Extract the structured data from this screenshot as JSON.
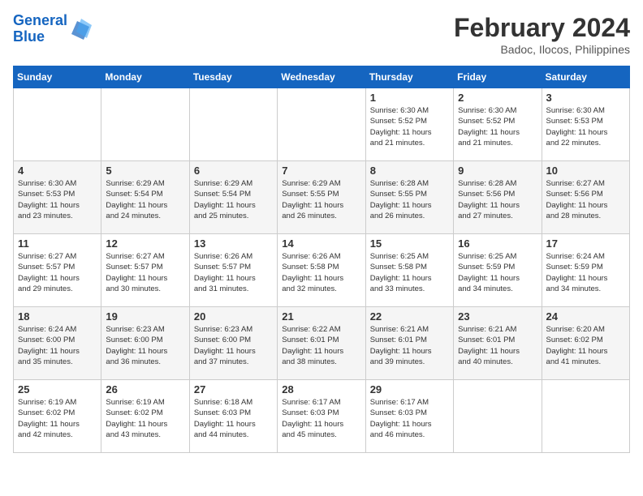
{
  "header": {
    "logo_line1": "General",
    "logo_line2": "Blue",
    "month_year": "February 2024",
    "location": "Badoc, Ilocos, Philippines"
  },
  "weekdays": [
    "Sunday",
    "Monday",
    "Tuesday",
    "Wednesday",
    "Thursday",
    "Friday",
    "Saturday"
  ],
  "weeks": [
    [
      {
        "day": "",
        "detail": ""
      },
      {
        "day": "",
        "detail": ""
      },
      {
        "day": "",
        "detail": ""
      },
      {
        "day": "",
        "detail": ""
      },
      {
        "day": "1",
        "detail": "Sunrise: 6:30 AM\nSunset: 5:52 PM\nDaylight: 11 hours\nand 21 minutes."
      },
      {
        "day": "2",
        "detail": "Sunrise: 6:30 AM\nSunset: 5:52 PM\nDaylight: 11 hours\nand 21 minutes."
      },
      {
        "day": "3",
        "detail": "Sunrise: 6:30 AM\nSunset: 5:53 PM\nDaylight: 11 hours\nand 22 minutes."
      }
    ],
    [
      {
        "day": "4",
        "detail": "Sunrise: 6:30 AM\nSunset: 5:53 PM\nDaylight: 11 hours\nand 23 minutes."
      },
      {
        "day": "5",
        "detail": "Sunrise: 6:29 AM\nSunset: 5:54 PM\nDaylight: 11 hours\nand 24 minutes."
      },
      {
        "day": "6",
        "detail": "Sunrise: 6:29 AM\nSunset: 5:54 PM\nDaylight: 11 hours\nand 25 minutes."
      },
      {
        "day": "7",
        "detail": "Sunrise: 6:29 AM\nSunset: 5:55 PM\nDaylight: 11 hours\nand 26 minutes."
      },
      {
        "day": "8",
        "detail": "Sunrise: 6:28 AM\nSunset: 5:55 PM\nDaylight: 11 hours\nand 26 minutes."
      },
      {
        "day": "9",
        "detail": "Sunrise: 6:28 AM\nSunset: 5:56 PM\nDaylight: 11 hours\nand 27 minutes."
      },
      {
        "day": "10",
        "detail": "Sunrise: 6:27 AM\nSunset: 5:56 PM\nDaylight: 11 hours\nand 28 minutes."
      }
    ],
    [
      {
        "day": "11",
        "detail": "Sunrise: 6:27 AM\nSunset: 5:57 PM\nDaylight: 11 hours\nand 29 minutes."
      },
      {
        "day": "12",
        "detail": "Sunrise: 6:27 AM\nSunset: 5:57 PM\nDaylight: 11 hours\nand 30 minutes."
      },
      {
        "day": "13",
        "detail": "Sunrise: 6:26 AM\nSunset: 5:57 PM\nDaylight: 11 hours\nand 31 minutes."
      },
      {
        "day": "14",
        "detail": "Sunrise: 6:26 AM\nSunset: 5:58 PM\nDaylight: 11 hours\nand 32 minutes."
      },
      {
        "day": "15",
        "detail": "Sunrise: 6:25 AM\nSunset: 5:58 PM\nDaylight: 11 hours\nand 33 minutes."
      },
      {
        "day": "16",
        "detail": "Sunrise: 6:25 AM\nSunset: 5:59 PM\nDaylight: 11 hours\nand 34 minutes."
      },
      {
        "day": "17",
        "detail": "Sunrise: 6:24 AM\nSunset: 5:59 PM\nDaylight: 11 hours\nand 34 minutes."
      }
    ],
    [
      {
        "day": "18",
        "detail": "Sunrise: 6:24 AM\nSunset: 6:00 PM\nDaylight: 11 hours\nand 35 minutes."
      },
      {
        "day": "19",
        "detail": "Sunrise: 6:23 AM\nSunset: 6:00 PM\nDaylight: 11 hours\nand 36 minutes."
      },
      {
        "day": "20",
        "detail": "Sunrise: 6:23 AM\nSunset: 6:00 PM\nDaylight: 11 hours\nand 37 minutes."
      },
      {
        "day": "21",
        "detail": "Sunrise: 6:22 AM\nSunset: 6:01 PM\nDaylight: 11 hours\nand 38 minutes."
      },
      {
        "day": "22",
        "detail": "Sunrise: 6:21 AM\nSunset: 6:01 PM\nDaylight: 11 hours\nand 39 minutes."
      },
      {
        "day": "23",
        "detail": "Sunrise: 6:21 AM\nSunset: 6:01 PM\nDaylight: 11 hours\nand 40 minutes."
      },
      {
        "day": "24",
        "detail": "Sunrise: 6:20 AM\nSunset: 6:02 PM\nDaylight: 11 hours\nand 41 minutes."
      }
    ],
    [
      {
        "day": "25",
        "detail": "Sunrise: 6:19 AM\nSunset: 6:02 PM\nDaylight: 11 hours\nand 42 minutes."
      },
      {
        "day": "26",
        "detail": "Sunrise: 6:19 AM\nSunset: 6:02 PM\nDaylight: 11 hours\nand 43 minutes."
      },
      {
        "day": "27",
        "detail": "Sunrise: 6:18 AM\nSunset: 6:03 PM\nDaylight: 11 hours\nand 44 minutes."
      },
      {
        "day": "28",
        "detail": "Sunrise: 6:17 AM\nSunset: 6:03 PM\nDaylight: 11 hours\nand 45 minutes."
      },
      {
        "day": "29",
        "detail": "Sunrise: 6:17 AM\nSunset: 6:03 PM\nDaylight: 11 hours\nand 46 minutes."
      },
      {
        "day": "",
        "detail": ""
      },
      {
        "day": "",
        "detail": ""
      }
    ]
  ]
}
